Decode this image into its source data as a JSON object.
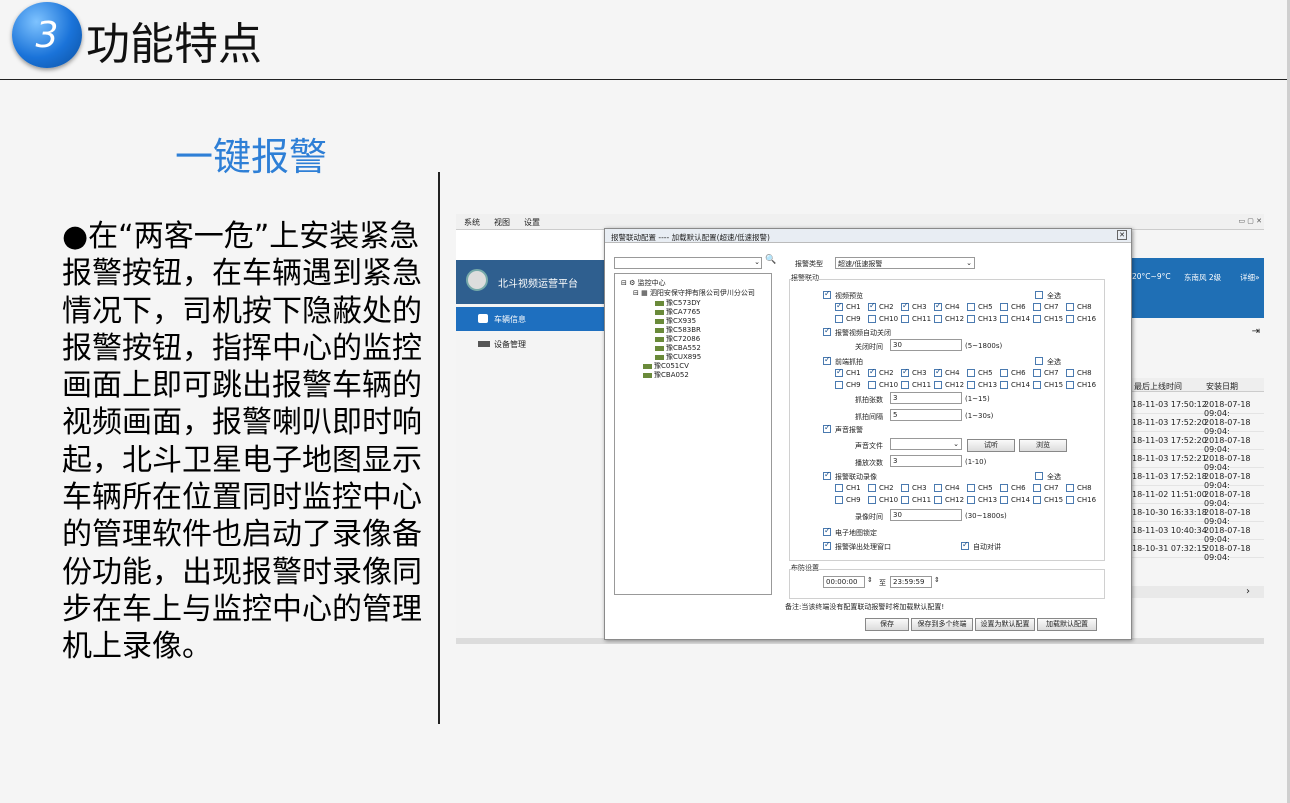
{
  "slide": {
    "number": "3",
    "title": "功能特点",
    "subtitle": "一键报警",
    "body": "●在“两客一危”上安装紧急报警按钮，在车辆遇到紧急情况下，司机按下隐蔽处的报警按钮，指挥中心的监控画面上即可跳出报警车辆的视频画面，报警喇叭即时响起，北斗卫星电子地图显示车辆所在位置同时监控中心的管理软件也启动了录像备份功能，出现报警时录像同步在车上与监控中心的管理机上录像。"
  },
  "app": {
    "menu": [
      "系统",
      "视图",
      "设置"
    ],
    "name": "北斗视频运营平台",
    "nav": [
      "车辆信息",
      "设备管理"
    ],
    "weather": {
      "temp": "20°C~9°C",
      "wind": "东南风 2级",
      "detail": "详细»"
    },
    "table": {
      "headers": [
        "最后上线时间",
        "安装日期"
      ],
      "rows": [
        [
          "18-11-03 17:50:12",
          "2018-07-18 09:04:"
        ],
        [
          "18-11-03 17:52:20",
          "2018-07-18 09:04:"
        ],
        [
          "18-11-03 17:52:20",
          "2018-07-18 09:04:"
        ],
        [
          "18-11-03 17:52:21",
          "2018-07-18 09:04:"
        ],
        [
          "18-11-03 17:52:18",
          "2018-07-18 09:04:"
        ],
        [
          "18-11-02 11:51:00",
          "2018-07-18 09:04:"
        ],
        [
          "18-10-30 16:33:18",
          "2018-07-18 09:04:"
        ],
        [
          "18-11-03 10:40:34",
          "2018-07-18 09:04:"
        ],
        [
          "18-10-31 07:32:15",
          "2018-07-18 09:04:"
        ]
      ]
    }
  },
  "dialog": {
    "title": "报警联动配置 ---- 加载默认配置(超速/低速报警)",
    "tree": {
      "root": "监控中心",
      "company": "泗阳安保守押有限公司伊川分公司",
      "vehicles": [
        "豫C573DY",
        "豫CA7765",
        "豫CX935",
        "豫C583BR",
        "豫C72086",
        "豫CBA552",
        "豫CUX895",
        "豫C051CV",
        "豫CBA052"
      ]
    },
    "alarm_type_label": "报警类型",
    "alarm_type_value": "超速/低速报警",
    "link_group": "报警联动",
    "video_preview": "视频预览",
    "select_all": "全选",
    "channels": [
      "CH1",
      "CH2",
      "CH3",
      "CH4",
      "CH5",
      "CH6",
      "CH7",
      "CH8",
      "CH9",
      "CH10",
      "CH11",
      "CH12",
      "CH13",
      "CH14",
      "CH15",
      "CH16"
    ],
    "video_checked": [
      true,
      true,
      true,
      true,
      false,
      false,
      false,
      false,
      false,
      false,
      false,
      false,
      false,
      false,
      false,
      false
    ],
    "auto_close": "报警视频自动关闭",
    "close_time_label": "关闭时间",
    "close_time_value": "30",
    "close_time_range": "(5~1800s)",
    "capture": "前端抓拍",
    "capture_checked": [
      true,
      true,
      true,
      true,
      false,
      false,
      false,
      false,
      false,
      false,
      false,
      false,
      false,
      false,
      false,
      false
    ],
    "capture_count_label": "抓拍张数",
    "capture_count_value": "3",
    "capture_count_range": "(1~15)",
    "capture_interval_label": "抓拍间隔",
    "capture_interval_value": "5",
    "capture_interval_range": "(1~30s)",
    "sound": "声音报警",
    "sound_file_label": "声音文件",
    "listen_button": "试听",
    "browse_button": "浏览",
    "play_times_label": "播放次数",
    "play_times_value": "3",
    "play_times_range": "(1-10)",
    "record": "报警联动录像",
    "record_checked": [
      false,
      false,
      false,
      false,
      false,
      false,
      false,
      false,
      false,
      false,
      false,
      false,
      false,
      false,
      false,
      false
    ],
    "record_time_label": "录像时间",
    "record_time_value": "30",
    "record_time_range": "(30~1800s)",
    "map_lock": "电子地图锁定",
    "popup_window": "报警弹出处理窗口",
    "auto_talk": "自动对讲",
    "defense_group": "布防设置",
    "time_from": "00:00:00",
    "time_to_label": "至",
    "time_to": "23:59:59",
    "note": "备注:当该终端没有配置联动报警时将加载默认配置!",
    "buttons": [
      "保存",
      "保存到多个终端",
      "设置为默认配置",
      "加载默认配置"
    ]
  },
  "colors": {
    "accent": "#2e7fd6",
    "app_blue": "#1e6fbf"
  }
}
